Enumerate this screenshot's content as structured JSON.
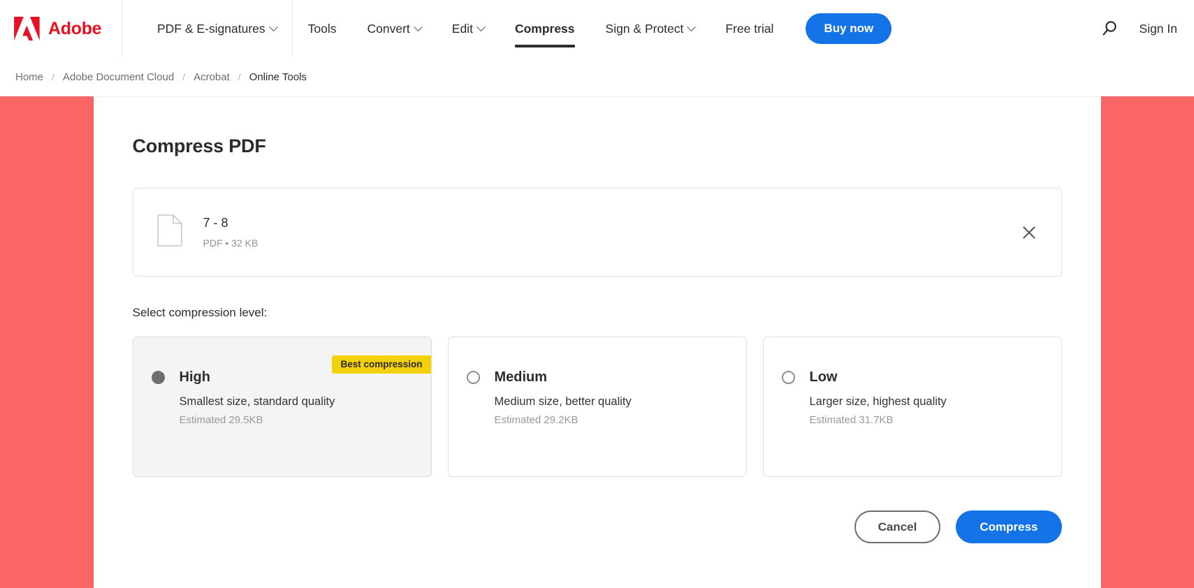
{
  "header": {
    "brand_name": "Adobe",
    "logo_icon": "adobe-logo-icon",
    "nav_items": [
      {
        "label": "PDF & E-signatures",
        "has_dropdown": true,
        "active": false
      },
      {
        "label": "Tools",
        "has_dropdown": false,
        "active": false
      },
      {
        "label": "Convert",
        "has_dropdown": true,
        "active": false
      },
      {
        "label": "Edit",
        "has_dropdown": true,
        "active": false
      },
      {
        "label": "Compress",
        "has_dropdown": false,
        "active": true
      },
      {
        "label": "Sign & Protect",
        "has_dropdown": true,
        "active": false
      },
      {
        "label": "Free trial",
        "has_dropdown": false,
        "active": false
      }
    ],
    "buy_now_label": "Buy now",
    "search_icon": "search-icon",
    "sign_in_label": "Sign In",
    "accent_blue": "#1473e6",
    "brand_red": "#e81123"
  },
  "breadcrumb": {
    "separator": "/",
    "items": [
      {
        "label": "Home",
        "current": false
      },
      {
        "label": "Adobe Document Cloud",
        "current": false
      },
      {
        "label": "Acrobat",
        "current": false
      },
      {
        "label": "Online Tools",
        "current": true
      }
    ]
  },
  "main": {
    "page_title": "Compress PDF",
    "background_accent": "#fa6565",
    "file": {
      "icon": "document-file-icon",
      "name": "7 - 8",
      "type": "PDF",
      "size": "32 KB",
      "meta_line": "PDF • 32 KB",
      "remove_icon": "close-icon"
    },
    "select_label": "Select compression level:",
    "badge_color": "#f2d00a",
    "options": [
      {
        "id": "high",
        "title": "High",
        "description": "Smallest size, standard quality",
        "estimate": "Estimated 29.5KB",
        "badge": "Best compression",
        "selected": true
      },
      {
        "id": "medium",
        "title": "Medium",
        "description": "Medium size, better quality",
        "estimate": "Estimated 29.2KB",
        "badge": "",
        "selected": false
      },
      {
        "id": "low",
        "title": "Low",
        "description": "Larger size, highest quality",
        "estimate": "Estimated 31.7KB",
        "badge": "",
        "selected": false
      }
    ],
    "cancel_label": "Cancel",
    "compress_label": "Compress"
  }
}
